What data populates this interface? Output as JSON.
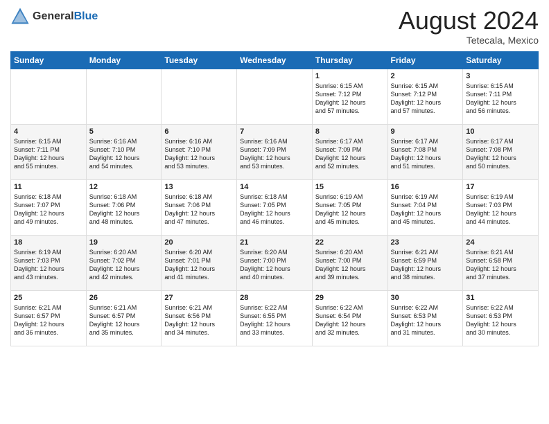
{
  "header": {
    "logo_general": "General",
    "logo_blue": "Blue",
    "month": "August 2024",
    "location": "Tetecala, Mexico"
  },
  "days_of_week": [
    "Sunday",
    "Monday",
    "Tuesday",
    "Wednesday",
    "Thursday",
    "Friday",
    "Saturday"
  ],
  "weeks": [
    [
      {
        "day": "",
        "content": ""
      },
      {
        "day": "",
        "content": ""
      },
      {
        "day": "",
        "content": ""
      },
      {
        "day": "",
        "content": ""
      },
      {
        "day": "1",
        "content": "Sunrise: 6:15 AM\nSunset: 7:12 PM\nDaylight: 12 hours\nand 57 minutes."
      },
      {
        "day": "2",
        "content": "Sunrise: 6:15 AM\nSunset: 7:12 PM\nDaylight: 12 hours\nand 57 minutes."
      },
      {
        "day": "3",
        "content": "Sunrise: 6:15 AM\nSunset: 7:11 PM\nDaylight: 12 hours\nand 56 minutes."
      }
    ],
    [
      {
        "day": "4",
        "content": "Sunrise: 6:15 AM\nSunset: 7:11 PM\nDaylight: 12 hours\nand 55 minutes."
      },
      {
        "day": "5",
        "content": "Sunrise: 6:16 AM\nSunset: 7:10 PM\nDaylight: 12 hours\nand 54 minutes."
      },
      {
        "day": "6",
        "content": "Sunrise: 6:16 AM\nSunset: 7:10 PM\nDaylight: 12 hours\nand 53 minutes."
      },
      {
        "day": "7",
        "content": "Sunrise: 6:16 AM\nSunset: 7:09 PM\nDaylight: 12 hours\nand 53 minutes."
      },
      {
        "day": "8",
        "content": "Sunrise: 6:17 AM\nSunset: 7:09 PM\nDaylight: 12 hours\nand 52 minutes."
      },
      {
        "day": "9",
        "content": "Sunrise: 6:17 AM\nSunset: 7:08 PM\nDaylight: 12 hours\nand 51 minutes."
      },
      {
        "day": "10",
        "content": "Sunrise: 6:17 AM\nSunset: 7:08 PM\nDaylight: 12 hours\nand 50 minutes."
      }
    ],
    [
      {
        "day": "11",
        "content": "Sunrise: 6:18 AM\nSunset: 7:07 PM\nDaylight: 12 hours\nand 49 minutes."
      },
      {
        "day": "12",
        "content": "Sunrise: 6:18 AM\nSunset: 7:06 PM\nDaylight: 12 hours\nand 48 minutes."
      },
      {
        "day": "13",
        "content": "Sunrise: 6:18 AM\nSunset: 7:06 PM\nDaylight: 12 hours\nand 47 minutes."
      },
      {
        "day": "14",
        "content": "Sunrise: 6:18 AM\nSunset: 7:05 PM\nDaylight: 12 hours\nand 46 minutes."
      },
      {
        "day": "15",
        "content": "Sunrise: 6:19 AM\nSunset: 7:05 PM\nDaylight: 12 hours\nand 45 minutes."
      },
      {
        "day": "16",
        "content": "Sunrise: 6:19 AM\nSunset: 7:04 PM\nDaylight: 12 hours\nand 45 minutes."
      },
      {
        "day": "17",
        "content": "Sunrise: 6:19 AM\nSunset: 7:03 PM\nDaylight: 12 hours\nand 44 minutes."
      }
    ],
    [
      {
        "day": "18",
        "content": "Sunrise: 6:19 AM\nSunset: 7:03 PM\nDaylight: 12 hours\nand 43 minutes."
      },
      {
        "day": "19",
        "content": "Sunrise: 6:20 AM\nSunset: 7:02 PM\nDaylight: 12 hours\nand 42 minutes."
      },
      {
        "day": "20",
        "content": "Sunrise: 6:20 AM\nSunset: 7:01 PM\nDaylight: 12 hours\nand 41 minutes."
      },
      {
        "day": "21",
        "content": "Sunrise: 6:20 AM\nSunset: 7:00 PM\nDaylight: 12 hours\nand 40 minutes."
      },
      {
        "day": "22",
        "content": "Sunrise: 6:20 AM\nSunset: 7:00 PM\nDaylight: 12 hours\nand 39 minutes."
      },
      {
        "day": "23",
        "content": "Sunrise: 6:21 AM\nSunset: 6:59 PM\nDaylight: 12 hours\nand 38 minutes."
      },
      {
        "day": "24",
        "content": "Sunrise: 6:21 AM\nSunset: 6:58 PM\nDaylight: 12 hours\nand 37 minutes."
      }
    ],
    [
      {
        "day": "25",
        "content": "Sunrise: 6:21 AM\nSunset: 6:57 PM\nDaylight: 12 hours\nand 36 minutes."
      },
      {
        "day": "26",
        "content": "Sunrise: 6:21 AM\nSunset: 6:57 PM\nDaylight: 12 hours\nand 35 minutes."
      },
      {
        "day": "27",
        "content": "Sunrise: 6:21 AM\nSunset: 6:56 PM\nDaylight: 12 hours\nand 34 minutes."
      },
      {
        "day": "28",
        "content": "Sunrise: 6:22 AM\nSunset: 6:55 PM\nDaylight: 12 hours\nand 33 minutes."
      },
      {
        "day": "29",
        "content": "Sunrise: 6:22 AM\nSunset: 6:54 PM\nDaylight: 12 hours\nand 32 minutes."
      },
      {
        "day": "30",
        "content": "Sunrise: 6:22 AM\nSunset: 6:53 PM\nDaylight: 12 hours\nand 31 minutes."
      },
      {
        "day": "31",
        "content": "Sunrise: 6:22 AM\nSunset: 6:53 PM\nDaylight: 12 hours\nand 30 minutes."
      }
    ]
  ]
}
